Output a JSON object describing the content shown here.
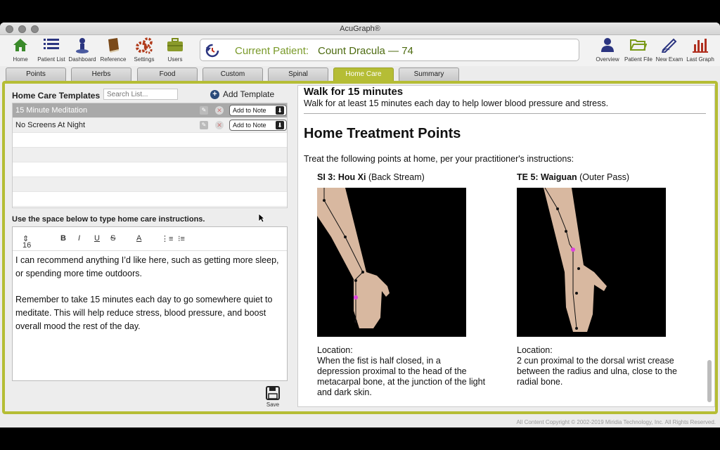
{
  "window": {
    "title": "AcuGraph®"
  },
  "toolbar": {
    "left_items": [
      {
        "label": "Home",
        "icon": "home-icon"
      },
      {
        "label": "Patient List",
        "icon": "list-icon"
      },
      {
        "label": "Dashboard",
        "icon": "dashboard-icon"
      },
      {
        "label": "Reference",
        "icon": "book-icon"
      },
      {
        "label": "Settings",
        "icon": "gear-icon"
      },
      {
        "label": "Users",
        "icon": "briefcase-icon"
      }
    ],
    "right_items": [
      {
        "label": "Overview",
        "icon": "person-icon"
      },
      {
        "label": "Patient File",
        "icon": "folder-icon"
      },
      {
        "label": "New Exam",
        "icon": "pen-icon"
      },
      {
        "label": "Last Graph",
        "icon": "bar-chart-icon"
      }
    ],
    "current_patient_label": "Current Patient:",
    "current_patient_name": "Count Dracula — 74"
  },
  "tabs": [
    {
      "label": "Points"
    },
    {
      "label": "Herbs"
    },
    {
      "label": "Food"
    },
    {
      "label": "Custom"
    },
    {
      "label": "Spinal"
    },
    {
      "label": "Home Care",
      "active": true
    },
    {
      "label": "Summary"
    }
  ],
  "templates": {
    "heading": "Home Care Templates",
    "search_placeholder": "Search List...",
    "add_label": "Add Template",
    "add_to_note_label": "Add to Note",
    "items": [
      {
        "name": "15 Minute Meditation",
        "selected": true
      },
      {
        "name": "No Screens At Night",
        "selected": false
      }
    ]
  },
  "instructions": {
    "label": "Use the space below to type home care instructions.",
    "font_size": "16",
    "paragraph1": "I can recommend anything I’d like here, such as getting more sleep, or spending more time outdoors.",
    "paragraph2": "Remember to take 15 minutes each day to go somewhere quiet to meditate. This will help reduce stress, blood pressure, and boost overall mood the rest of the day.",
    "save_label": "Save"
  },
  "preview": {
    "title": "Walk for 15 minutes",
    "description": "Walk for at least 15 minutes each day to help lower blood pressure and stress.",
    "section_title": "Home Treatment Points",
    "intro": "Treat the following points at home, per your practitioner's instructions:",
    "points": [
      {
        "code": "SI 3: Hou Xi",
        "english": "(Back Stream)",
        "location_label": "Location:",
        "location": "When the fist is half closed, in a depression proximal to the head of the metacarpal bone, at the junction of the light and dark skin."
      },
      {
        "code": "TE 5: Waiguan",
        "english": "(Outer Pass)",
        "location_label": "Location:",
        "location": "2 cun proximal to the dorsal wrist crease between the radius and ulna, close to the radial bone."
      }
    ]
  },
  "footer": {
    "copyright": "All Content Copyright © 2002-2019 Miridia Technology, Inc.  All Rights Reserved."
  },
  "colors": {
    "accent": "#b5bd35",
    "patient_text": "#4d6b10",
    "home_icon": "#3a8a2a"
  }
}
